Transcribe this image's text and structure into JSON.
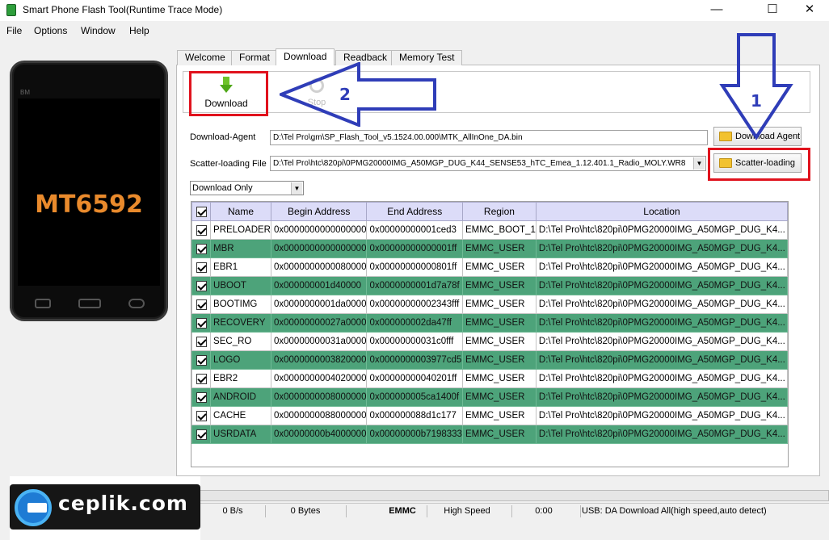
{
  "window": {
    "title": "Smart Phone Flash Tool(Runtime Trace Mode)",
    "minimize": "—",
    "maximize": "☐",
    "close": "✕"
  },
  "menu": [
    "File",
    "Options",
    "Window",
    "Help"
  ],
  "phone": {
    "brand": "BM",
    "chip": "MT6592"
  },
  "tabs": [
    "Welcome",
    "Format",
    "Download",
    "Readback",
    "Memory Test"
  ],
  "active_tab": "Download",
  "toolbar": {
    "download_label": "Download",
    "stop_label": "Stop"
  },
  "download_agent": {
    "label": "Download-Agent",
    "value": "D:\\Tel Pro\\gm\\SP_Flash_Tool_v5.1524.00.000\\MTK_AllInOne_DA.bin",
    "button": "Download Agent"
  },
  "scatter": {
    "label": "Scatter-loading File",
    "value": "D:\\Tel Pro\\htc\\820pi\\0PMG20000IMG_A50MGP_DUG_K44_SENSE53_hTC_Emea_1.12.401.1_Radio_MOLY.WR8",
    "button": "Scatter-loading"
  },
  "mode": {
    "selected": "Download Only"
  },
  "table": {
    "columns": [
      "Name",
      "Begin Address",
      "End Address",
      "Region",
      "Location"
    ],
    "rows": [
      {
        "checked": true,
        "name": "PRELOADER",
        "begin": "0x0000000000000000",
        "end": "0x00000000001ced3",
        "region": "EMMC_BOOT_1",
        "location": "D:\\Tel Pro\\htc\\820pi\\0PMG20000IMG_A50MGP_DUG_K4..."
      },
      {
        "checked": true,
        "name": "MBR",
        "begin": "0x0000000000000000",
        "end": "0x00000000000001ff",
        "region": "EMMC_USER",
        "location": "D:\\Tel Pro\\htc\\820pi\\0PMG20000IMG_A50MGP_DUG_K4..."
      },
      {
        "checked": true,
        "name": "EBR1",
        "begin": "0x0000000000080000",
        "end": "0x00000000000801ff",
        "region": "EMMC_USER",
        "location": "D:\\Tel Pro\\htc\\820pi\\0PMG20000IMG_A50MGP_DUG_K4..."
      },
      {
        "checked": true,
        "name": "UBOOT",
        "begin": "0x000000001d40000",
        "end": "0x0000000001d7a78f",
        "region": "EMMC_USER",
        "location": "D:\\Tel Pro\\htc\\820pi\\0PMG20000IMG_A50MGP_DUG_K4..."
      },
      {
        "checked": true,
        "name": "BOOTIMG",
        "begin": "0x0000000001da0000",
        "end": "0x00000000002343fff",
        "region": "EMMC_USER",
        "location": "D:\\Tel Pro\\htc\\820pi\\0PMG20000IMG_A50MGP_DUG_K4..."
      },
      {
        "checked": true,
        "name": "RECOVERY",
        "begin": "0x00000000027a0000",
        "end": "0x000000002da47ff",
        "region": "EMMC_USER",
        "location": "D:\\Tel Pro\\htc\\820pi\\0PMG20000IMG_A50MGP_DUG_K4..."
      },
      {
        "checked": true,
        "name": "SEC_RO",
        "begin": "0x00000000031a0000",
        "end": "0x00000000031c0fff",
        "region": "EMMC_USER",
        "location": "D:\\Tel Pro\\htc\\820pi\\0PMG20000IMG_A50MGP_DUG_K4..."
      },
      {
        "checked": true,
        "name": "LOGO",
        "begin": "0x0000000003820000",
        "end": "0x0000000003977cd5",
        "region": "EMMC_USER",
        "location": "D:\\Tel Pro\\htc\\820pi\\0PMG20000IMG_A50MGP_DUG_K4..."
      },
      {
        "checked": true,
        "name": "EBR2",
        "begin": "0x0000000004020000",
        "end": "0x00000000040201ff",
        "region": "EMMC_USER",
        "location": "D:\\Tel Pro\\htc\\820pi\\0PMG20000IMG_A50MGP_DUG_K4..."
      },
      {
        "checked": true,
        "name": "ANDROID",
        "begin": "0x0000000008000000",
        "end": "0x000000005ca1400f",
        "region": "EMMC_USER",
        "location": "D:\\Tel Pro\\htc\\820pi\\0PMG20000IMG_A50MGP_DUG_K4..."
      },
      {
        "checked": true,
        "name": "CACHE",
        "begin": "0x0000000088000000",
        "end": "0x000000088d1c177",
        "region": "EMMC_USER",
        "location": "D:\\Tel Pro\\htc\\820pi\\0PMG20000IMG_A50MGP_DUG_K4..."
      },
      {
        "checked": true,
        "name": "USRDATA",
        "begin": "0x00000000b4000000",
        "end": "0x00000000b7198333",
        "region": "EMMC_USER",
        "location": "D:\\Tel Pro\\htc\\820pi\\0PMG20000IMG_A50MGP_DUG_K4..."
      }
    ]
  },
  "status": {
    "speed": "0 B/s",
    "bytes": "0 Bytes",
    "storage": "EMMC",
    "usb_speed": "High Speed",
    "time": "0:00",
    "message": "USB: DA Download All(high speed,auto detect)"
  },
  "annotations": {
    "step1": "1",
    "step2": "2",
    "color_box": "#e0121d",
    "color_arrow": "#2f3db8"
  },
  "watermark": {
    "text": "ceplik.com"
  },
  "colors": {
    "row_alt": "#4da37a",
    "header": "#dcdcf8",
    "chip_text": "#e98a2c"
  }
}
